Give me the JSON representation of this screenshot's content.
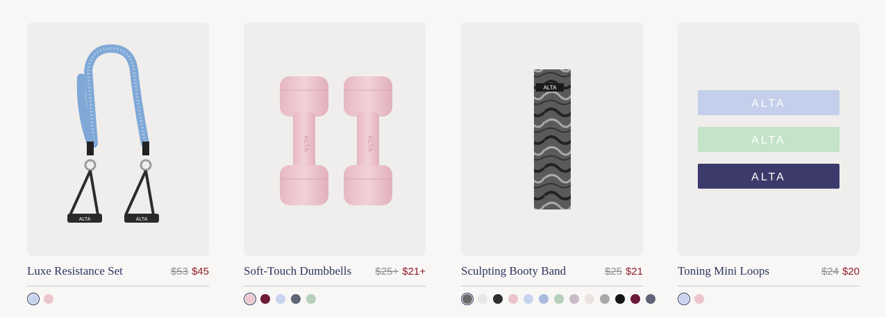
{
  "products": [
    {
      "name": "Luxe Resistance Set",
      "old_price": "$53",
      "price": "$45",
      "image_icon": "resistance-band-icon",
      "logo": "ALTA",
      "swatches": [
        "#c5d4ec",
        "#ebc5cc"
      ]
    },
    {
      "name": "Soft-Touch Dumbbells",
      "old_price": "$25+",
      "price": "$21+",
      "image_icon": "dumbbell-icon",
      "logo": "ALTA",
      "swatches": [
        "#eec9d0",
        "#6d1a3a",
        "#c8d4ee",
        "#5f6478",
        "#b7cfbd"
      ]
    },
    {
      "name": "Sculpting Booty Band",
      "old_price": "$25",
      "price": "$21",
      "image_icon": "booty-band-icon",
      "logo": "ALTA",
      "swatches": [
        "#6a6a6a",
        "#e7e7e7",
        "#2f2f2f",
        "#ebc5cc",
        "#c8d4ee",
        "#a9bbe0",
        "#b7cfbd",
        "#c9bcc6",
        "#ece2e2",
        "#a8a8a8",
        "#151515",
        "#6d1a3a",
        "#5f6478"
      ]
    },
    {
      "name": "Toning Mini Loops",
      "old_price": "$24",
      "price": "$20",
      "image_icon": "mini-loops-icon",
      "logo": "ALTA",
      "swatches": [
        "#c8d4ee",
        "#ebc5cc"
      ]
    }
  ]
}
